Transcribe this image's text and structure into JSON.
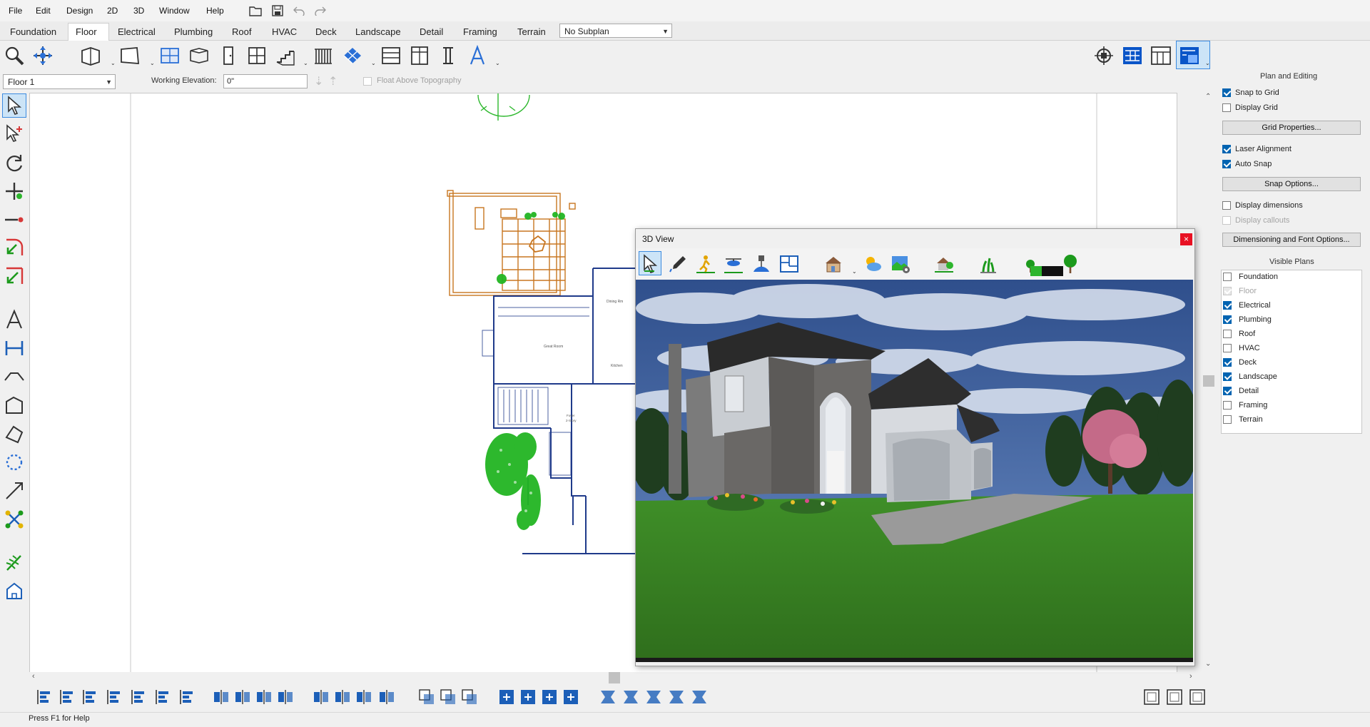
{
  "menu": {
    "file": "File",
    "edit": "Edit",
    "design": "Design",
    "twod": "2D",
    "threed": "3D",
    "window": "Window",
    "help": "Help"
  },
  "tabs": [
    "Foundation",
    "Floor",
    "Electrical",
    "Plumbing",
    "Roof",
    "HVAC",
    "Deck",
    "Landscape",
    "Detail",
    "Framing",
    "Terrain"
  ],
  "active_tab": "Floor",
  "subplan": {
    "value": "No Subplan"
  },
  "options": {
    "floor": "Floor 1",
    "working_elevation_label": "Working Elevation:",
    "working_elevation_value": "0\"",
    "float_label": "Float Above Topography"
  },
  "view3d": {
    "title": "3D View",
    "close": "×"
  },
  "right_panel": {
    "heading": "Plan and Editing",
    "snap_to_grid": "Snap to Grid",
    "display_grid": "Display Grid",
    "grid_properties": "Grid Properties...",
    "laser_alignment": "Laser Alignment",
    "auto_snap": "Auto Snap",
    "snap_options": "Snap Options...",
    "display_dimensions": "Display dimensions",
    "display_callouts": "Display callouts",
    "dim_font_options": "Dimensioning and Font Options...",
    "visible_plans_heading": "Visible Plans",
    "visible_plans": [
      {
        "label": "Foundation",
        "checked": false,
        "disabled": false
      },
      {
        "label": "Floor",
        "checked": true,
        "disabled": true
      },
      {
        "label": "Electrical",
        "checked": true,
        "disabled": false
      },
      {
        "label": "Plumbing",
        "checked": true,
        "disabled": false
      },
      {
        "label": "Roof",
        "checked": false,
        "disabled": false
      },
      {
        "label": "HVAC",
        "checked": false,
        "disabled": false
      },
      {
        "label": "Deck",
        "checked": true,
        "disabled": false
      },
      {
        "label": "Landscape",
        "checked": true,
        "disabled": false
      },
      {
        "label": "Detail",
        "checked": true,
        "disabled": false
      },
      {
        "label": "Framing",
        "checked": false,
        "disabled": false
      },
      {
        "label": "Terrain",
        "checked": false,
        "disabled": false
      }
    ]
  },
  "plan_labels": {
    "great_room": "Great Room",
    "dining": "Dining Rm",
    "kitchen": "Kitchen",
    "foyer": "Foyer",
    "foyer2": "2-Story"
  },
  "status": {
    "text": "Press F1 for Help"
  },
  "colors": {
    "accent": "#0063b1",
    "deck": "#c87620",
    "plan_line": "#1f3a8a",
    "landscape": "#22b522",
    "close": "#e81123"
  }
}
